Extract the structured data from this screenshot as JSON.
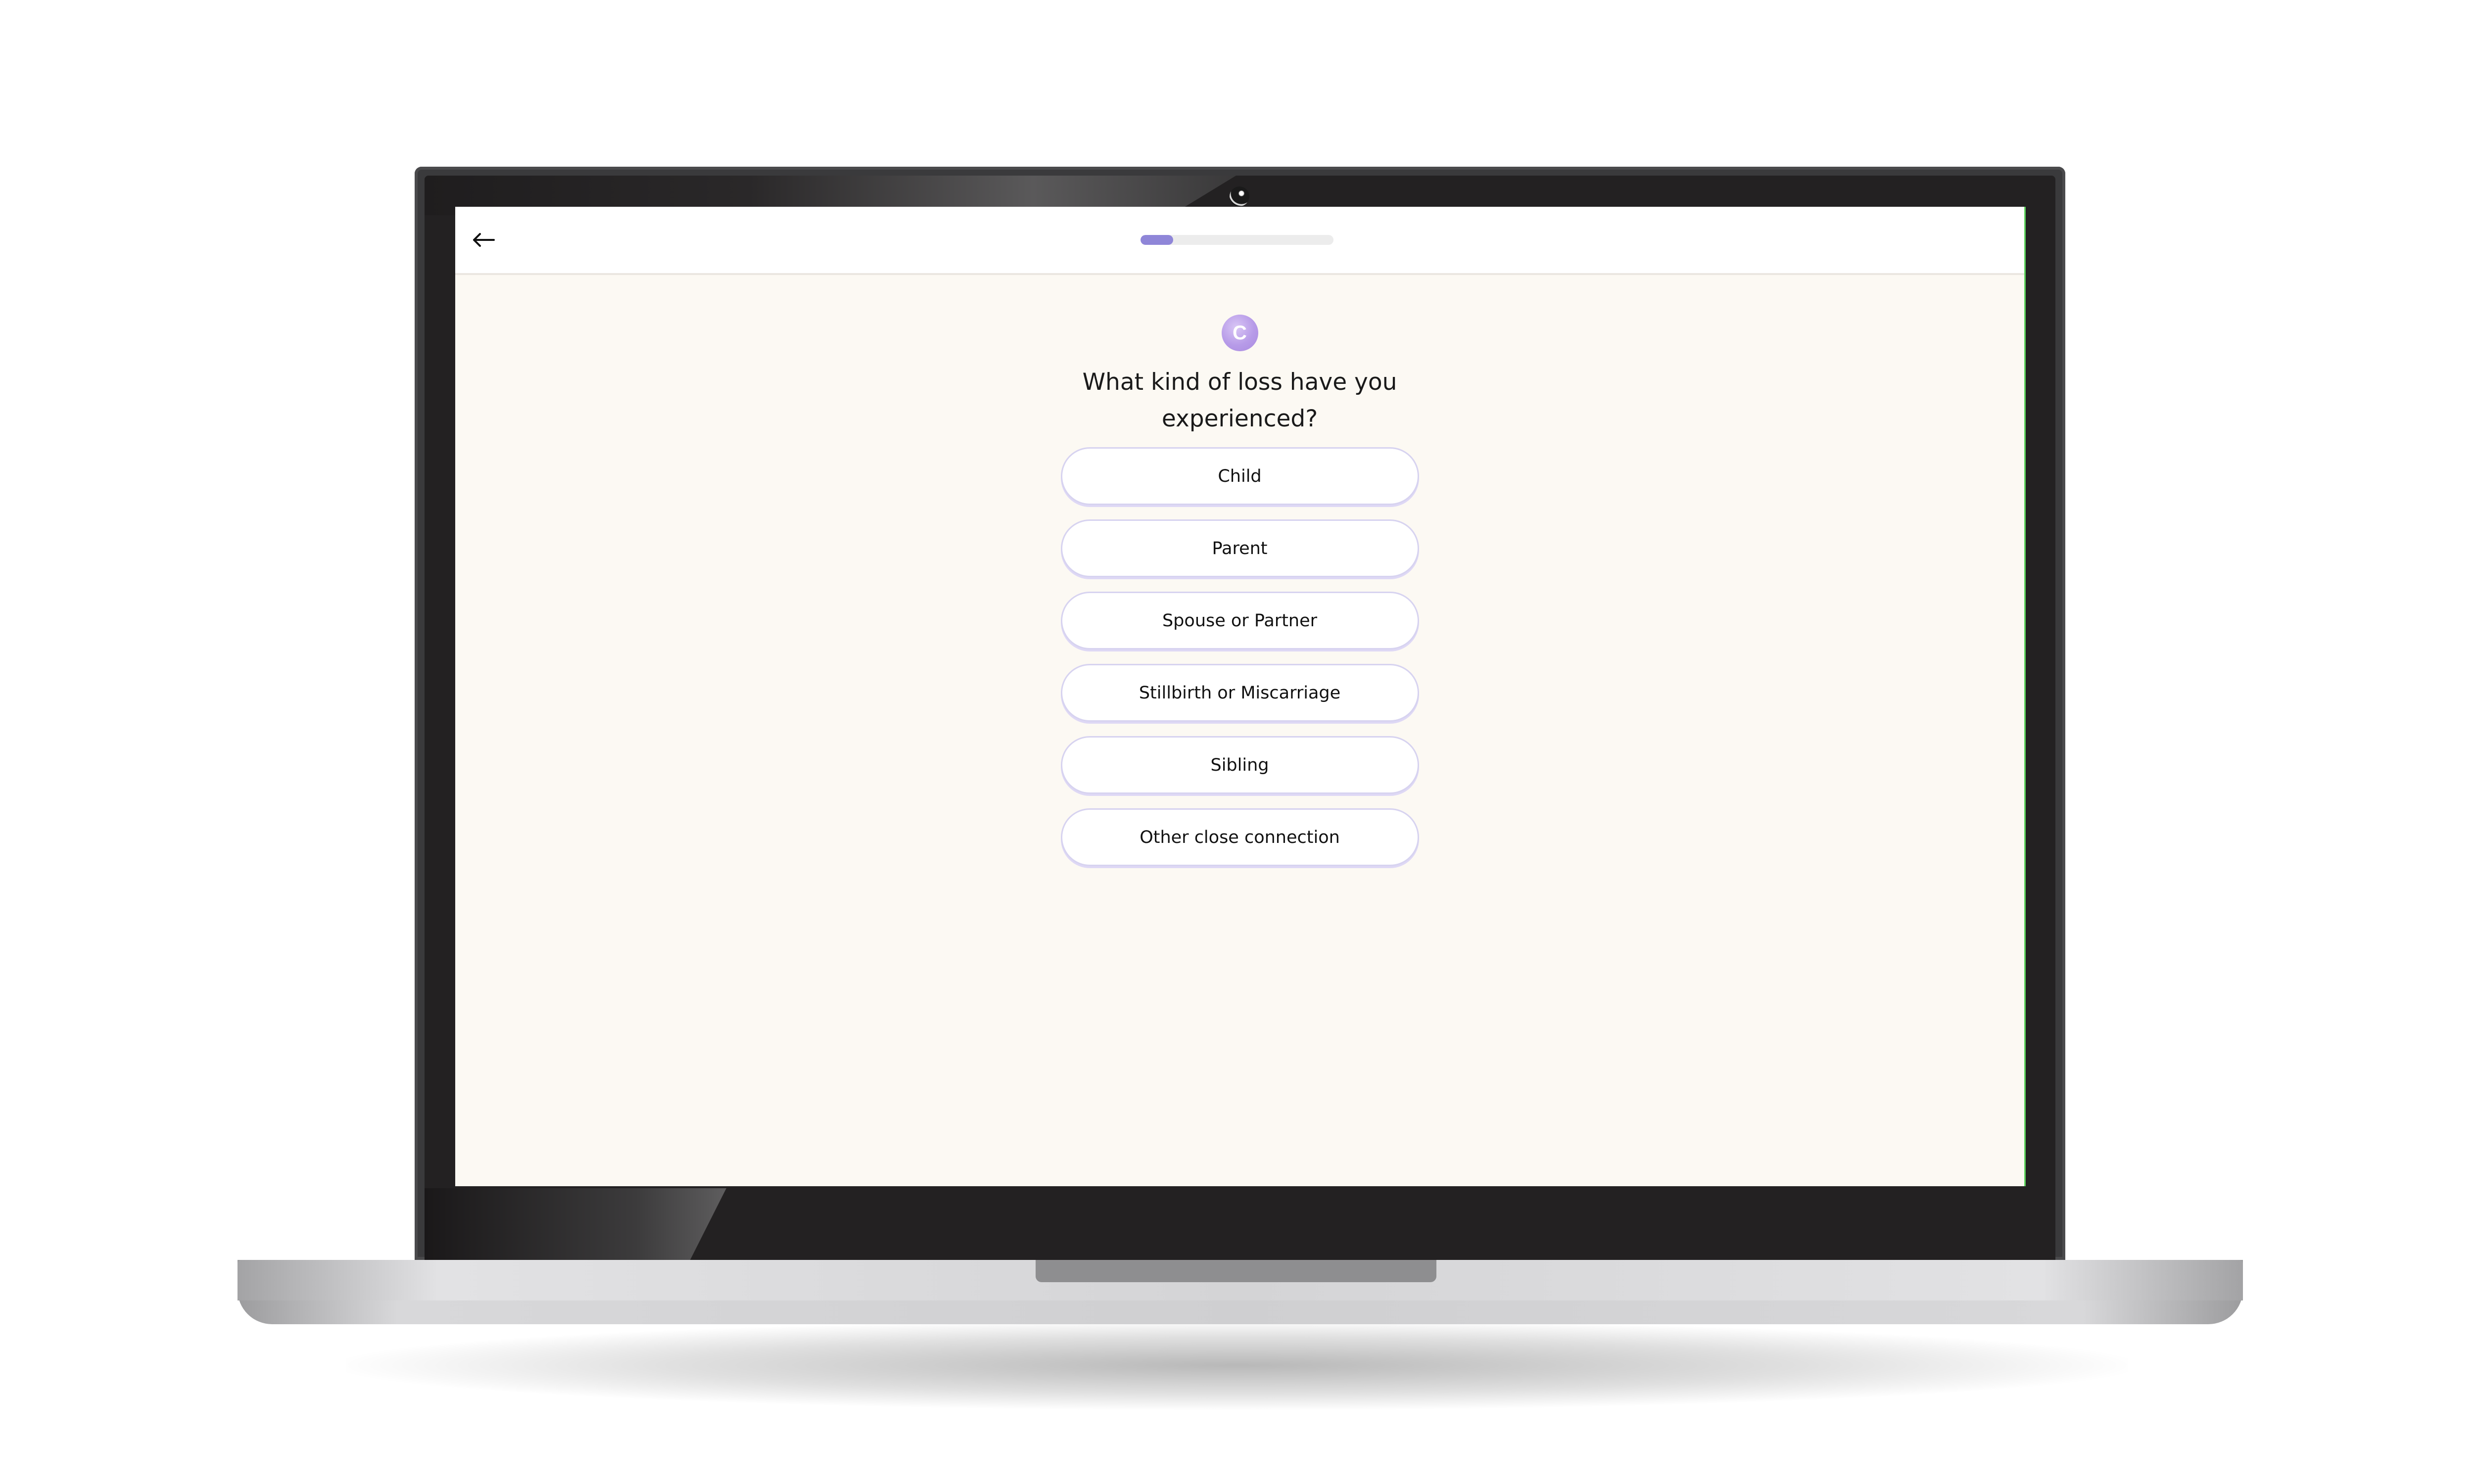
{
  "header": {
    "back_label": "←"
  },
  "progress": {
    "fraction": 0.17,
    "fill_color": "#8f86d8"
  },
  "logo": {
    "letter": "C"
  },
  "question": {
    "text": "What kind of loss have you experienced?"
  },
  "options": [
    {
      "label": "Child"
    },
    {
      "label": "Parent"
    },
    {
      "label": "Spouse or Partner"
    },
    {
      "label": "Stillbirth or Miscarriage"
    },
    {
      "label": "Sibling"
    },
    {
      "label": "Other close connection"
    }
  ],
  "icons": {
    "back": "arrow-left-icon",
    "camera": "webcam-icon"
  }
}
